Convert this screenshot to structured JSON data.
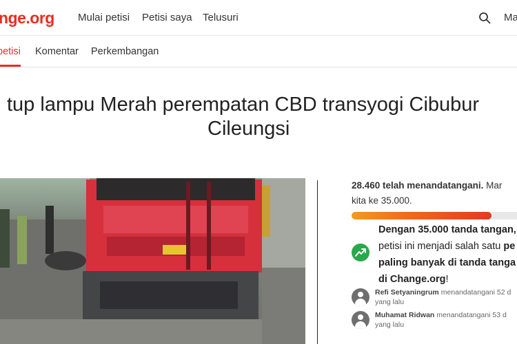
{
  "header": {
    "logo": "change.org",
    "logo_visible": "nge.org",
    "nav": [
      "Mulai petisi",
      "Petisi saya",
      "Telusuri"
    ],
    "right_text": "Ma"
  },
  "tabs": [
    {
      "label": "petisi",
      "active": true
    },
    {
      "label": "Komentar",
      "active": false
    },
    {
      "label": "Perkembangan",
      "active": false
    }
  ],
  "petition": {
    "title_line1": "tup lampu Merah perempatan CBD transyogi Cibubur",
    "title_line2": "Cileungsi"
  },
  "stats": {
    "signed_count": "28.460 telah menandatangani.",
    "signed_tail": "Mar",
    "goal_line": "kita ke 35.000.",
    "progress": 0.813
  },
  "goal_message": {
    "line1": "Dengan 35.000 tanda tangan,",
    "line2_a": "petisi ini menjadi salah satu ",
    "line2_b": "pe",
    "line3": "paling banyak di tanda tanga",
    "line4_a": "di Change.org",
    "line4_b": "!"
  },
  "recent_signers": [
    {
      "name": "Refi Setyaningrum",
      "action": "menandatangani 52 d",
      "sub": "yang lalu"
    },
    {
      "name": "Muhamat Ridwan",
      "action": "menandatangani 53 d",
      "sub": "yang lalu"
    }
  ],
  "colors": {
    "brand": "#ec2c22",
    "trend": "#2aa84a"
  }
}
